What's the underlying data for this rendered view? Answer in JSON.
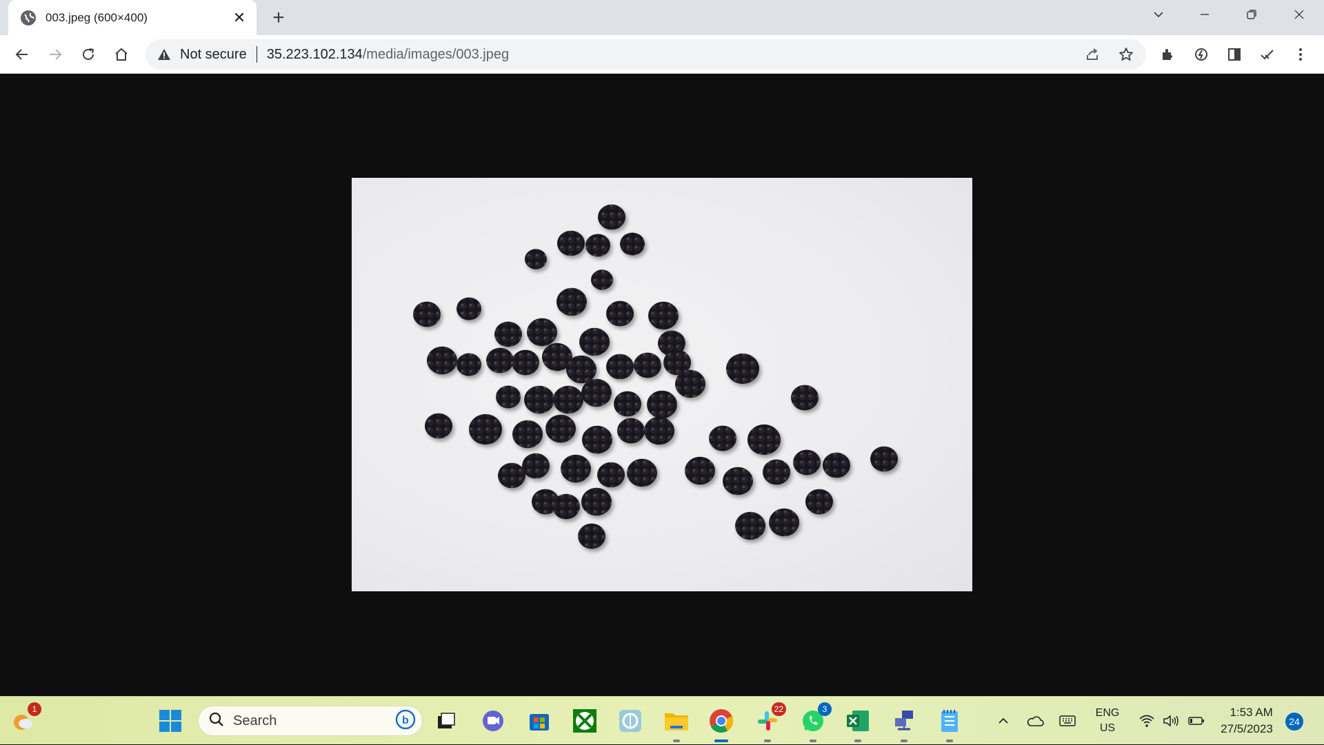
{
  "tab": {
    "title": "003.jpeg (600×400)"
  },
  "address": {
    "security_label": "Not secure",
    "host": "35.223.102.134",
    "path": "/media/images/003.jpeg"
  },
  "taskbar": {
    "search_label": "Search",
    "badges": {
      "widget": "1",
      "slack": "22",
      "whatsapp": "3"
    },
    "language_line1": "ENG",
    "language_line2": "US",
    "time": "1:53 AM",
    "date": "27/5/2023",
    "notification_count": "24"
  },
  "colors": {
    "tabstrip": "#dee1e6",
    "accent": "#0067c0",
    "viewport_bg": "#0e0e0e",
    "taskbar": "#e2ecae"
  },
  "icons": [
    "globe-icon",
    "close-icon",
    "plus-icon",
    "chevron-down-icon",
    "minimize-icon",
    "restore-icon",
    "window-close-icon",
    "back-icon",
    "forward-icon",
    "reload-icon",
    "home-icon",
    "warning-icon",
    "share-icon",
    "star-icon",
    "extensions-icon",
    "speed-icon",
    "sidepanel-icon",
    "check-icon",
    "menu-icon",
    "windows-start-icon",
    "search-icon",
    "bing-icon",
    "task-view-icon",
    "teams-icon",
    "store-icon",
    "xbox-icon",
    "app-icon",
    "file-explorer-icon",
    "chrome-icon",
    "slack-icon",
    "whatsapp-icon",
    "excel-icon",
    "network-app-icon",
    "notepad-icon",
    "chevron-up-icon",
    "onedrive-icon",
    "keyboard-icon",
    "wifi-icon",
    "volume-icon",
    "battery-icon"
  ]
}
